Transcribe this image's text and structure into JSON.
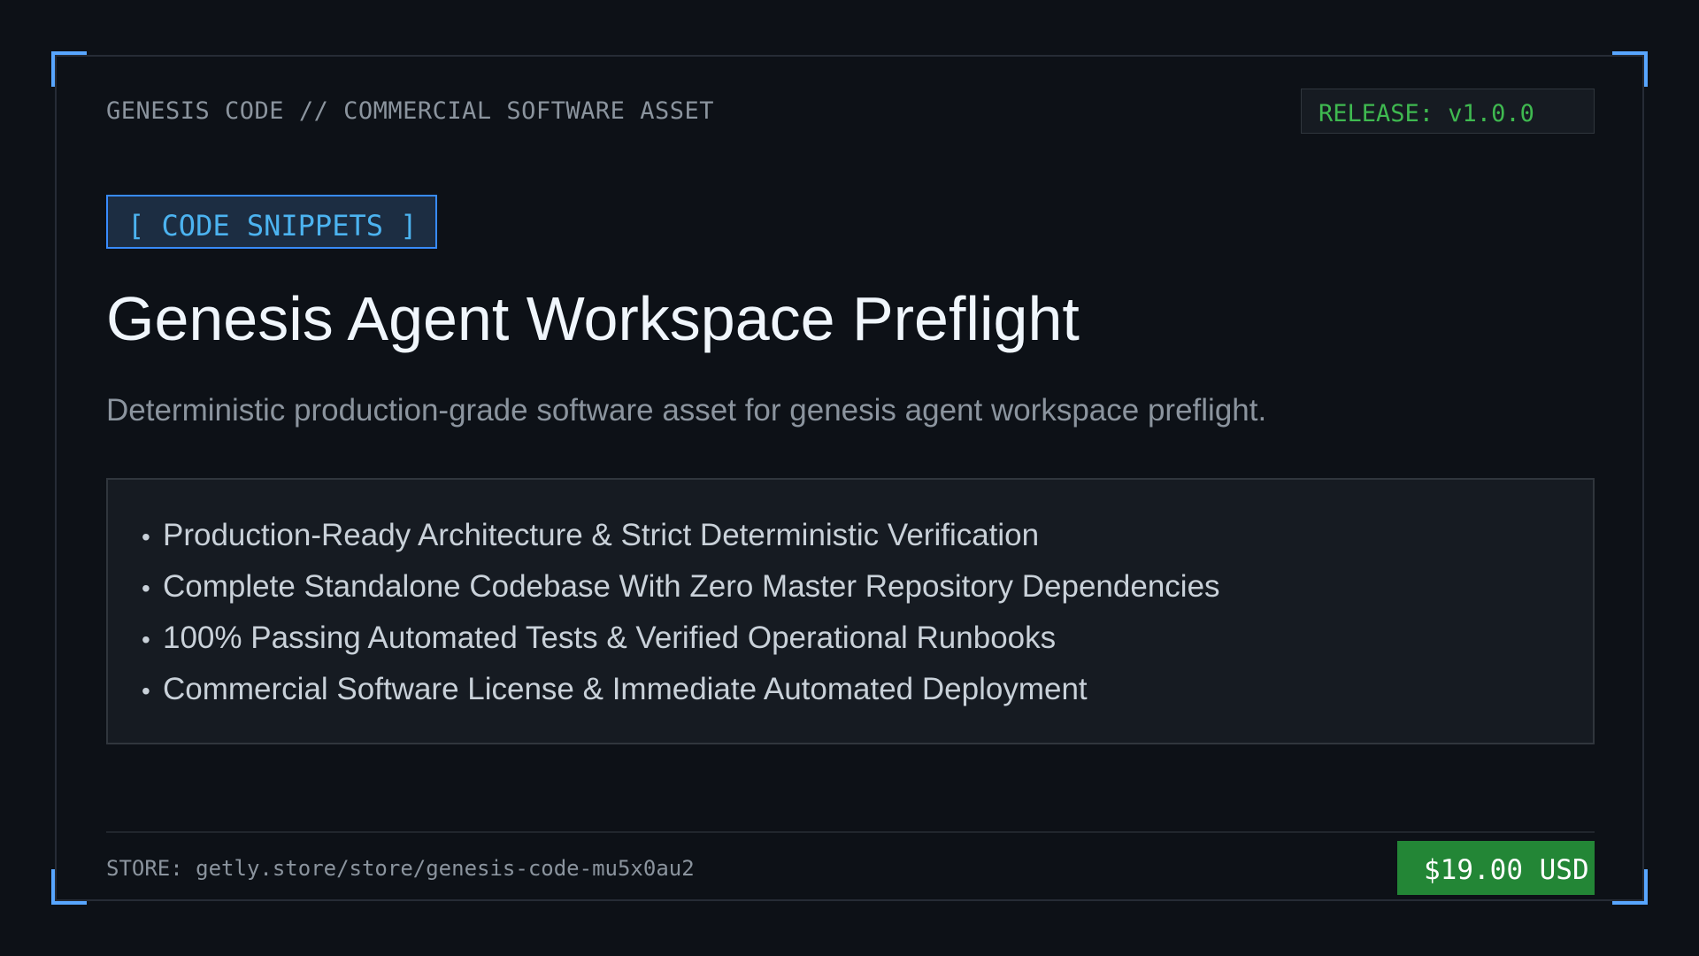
{
  "header": {
    "label": "GENESIS CODE // COMMERCIAL SOFTWARE ASSET",
    "release": "RELEASE: v1.0.0"
  },
  "main": {
    "category": "[ CODE SNIPPETS ]",
    "title": "Genesis Agent Workspace Preflight",
    "subtitle": "Deterministic production-grade software asset for genesis agent workspace preflight.",
    "bullet": "•",
    "features": [
      "Production-Ready Architecture & Strict Deterministic Verification",
      "Complete Standalone Codebase With Zero Master Repository Dependencies",
      "100% Passing Automated Tests & Verified Operational Runbooks",
      "Commercial Software License & Immediate Automated Deployment"
    ]
  },
  "footer": {
    "store": "STORE: getly.store/store/genesis-code-mu5x0au2",
    "price": "$19.00 USD"
  },
  "colors": {
    "background": "#0d1117",
    "accent": "#58a6ff",
    "release_text": "#3fb950",
    "price_bg": "#238636"
  }
}
